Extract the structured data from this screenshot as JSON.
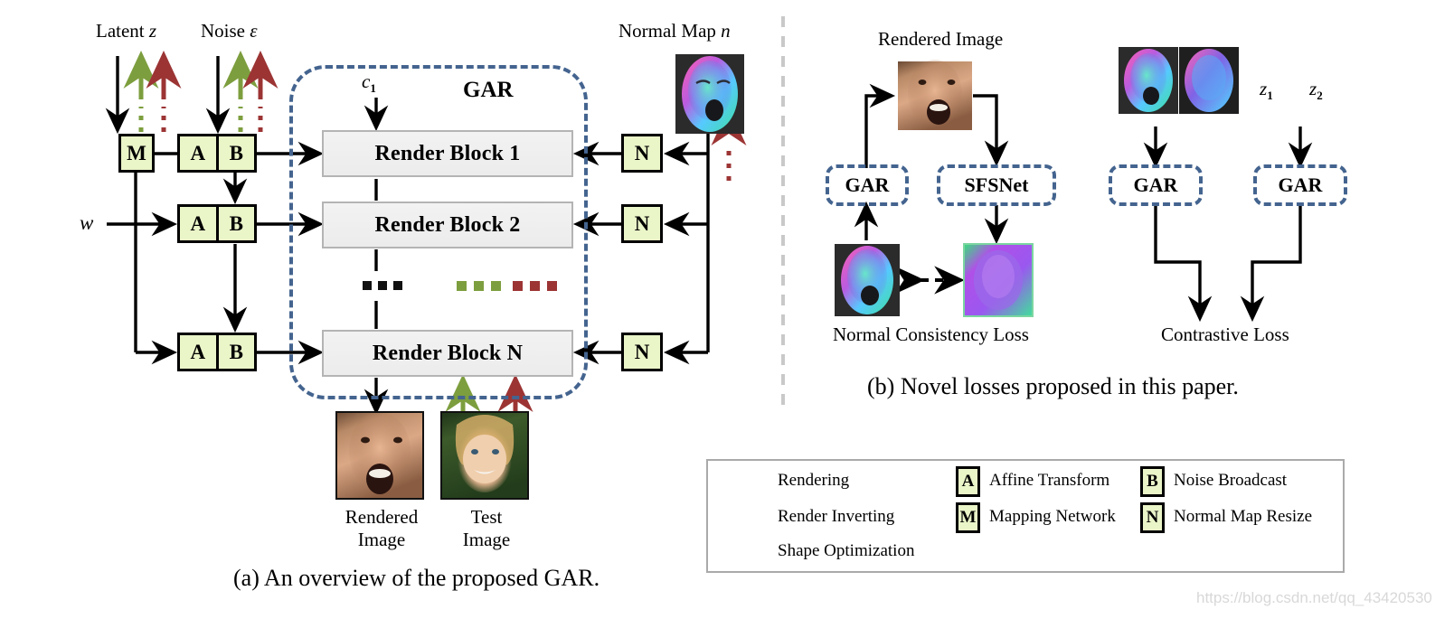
{
  "figure": {
    "caption_a": "(a) An overview of the proposed GAR.",
    "caption_b": "(b) Novel losses proposed in this paper.",
    "watermark": "https://blog.csdn.net/qq_43420530"
  },
  "panel_a": {
    "inputs": {
      "latent_label": "Latent",
      "latent_symbol": "z",
      "noise_label": "Noise",
      "noise_symbol": "ε",
      "w_symbol": "w",
      "constant_symbol": "c",
      "constant_sub": "1",
      "normal_map_label": "Normal Map",
      "normal_map_symbol": "n"
    },
    "gar_title": "GAR",
    "mapping_box": "M",
    "style_rows": [
      {
        "affine": "A",
        "broadcast": "B"
      },
      {
        "affine": "A",
        "broadcast": "B"
      },
      {
        "affine": "A",
        "broadcast": "B"
      }
    ],
    "render_blocks": [
      "Render Block 1",
      "Render Block 2",
      "Render Block N"
    ],
    "normal_resize_boxes": [
      "N",
      "N",
      "N"
    ],
    "ellipsis": "...",
    "outputs": [
      {
        "title_line1": "Rendered",
        "title_line2": "Image"
      },
      {
        "title_line1": "Test",
        "title_line2": "Image"
      }
    ]
  },
  "panel_b": {
    "rendered_image_label": "Rendered Image",
    "normal_consistency_label": "Normal Consistency Loss",
    "contrastive_label": "Contrastive Loss",
    "modules": [
      "GAR",
      "SFSNet",
      "GAR",
      "GAR"
    ],
    "latent_labels": [
      {
        "symbol": "z",
        "sub": "1"
      },
      {
        "symbol": "z",
        "sub": "2"
      }
    ]
  },
  "legend": {
    "arrows": [
      {
        "label": "Rendering",
        "color": "#000000"
      },
      {
        "label": "Render Inverting",
        "color": "#7d9e3e"
      },
      {
        "label": "Shape Optimization",
        "color": "#9c3434"
      }
    ],
    "boxes": [
      {
        "glyph": "A",
        "label": "Affine Transform"
      },
      {
        "glyph": "M",
        "label": "Mapping Network"
      },
      {
        "glyph": "B",
        "label": "Noise Broadcast"
      },
      {
        "glyph": "N",
        "label": "Normal Map Resize"
      }
    ]
  },
  "colors": {
    "green_arrow": "#7d9e3e",
    "red_arrow": "#9c3434",
    "dashed_blue": "#44648f",
    "box_fill": "#eaf5c8",
    "block_fill": "#f0f0f0"
  }
}
